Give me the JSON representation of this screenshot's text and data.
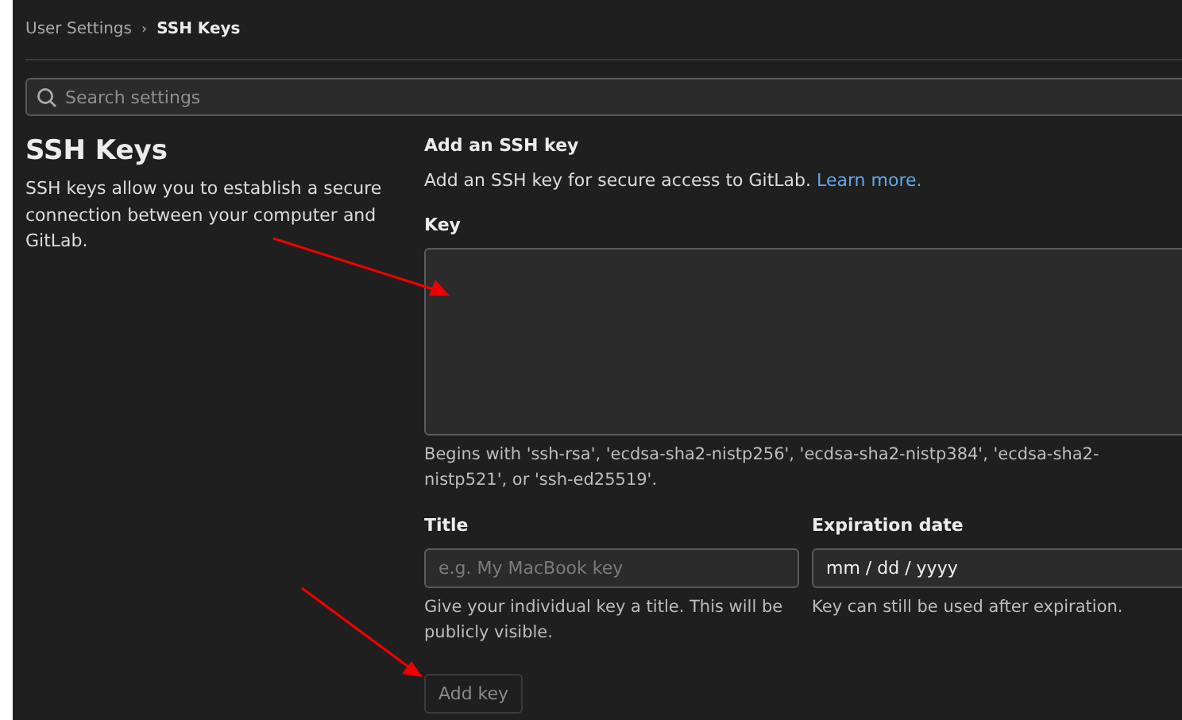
{
  "breadcrumb": [
    {
      "label": "User Settings",
      "current": false
    },
    {
      "label": "SSH Keys",
      "current": true
    }
  ],
  "breadcrumb_separator": "›",
  "search": {
    "placeholder": "Search settings"
  },
  "section": {
    "title": "SSH Keys",
    "description": "SSH keys allow you to establish a secure connection between your computer and GitLab."
  },
  "form": {
    "heading": "Add an SSH key",
    "intro": "Add an SSH key for secure access to GitLab.",
    "intro_link": "Learn more.",
    "key": {
      "label": "Key",
      "help": "Begins with 'ssh-rsa', 'ecdsa-sha2-nistp256', 'ecdsa-sha2-nistp384', 'ecdsa-sha2-nistp521', or 'ssh-ed25519'."
    },
    "title": {
      "label": "Title",
      "placeholder": "e.g. My MacBook key",
      "help": "Give your individual key a title. This will be publicly visible."
    },
    "expiration": {
      "label": "Expiration date",
      "value": "mm / dd / yyyy",
      "help": "Key can still be used after expiration."
    },
    "submit": {
      "label": "Add key",
      "disabled": true
    }
  }
}
